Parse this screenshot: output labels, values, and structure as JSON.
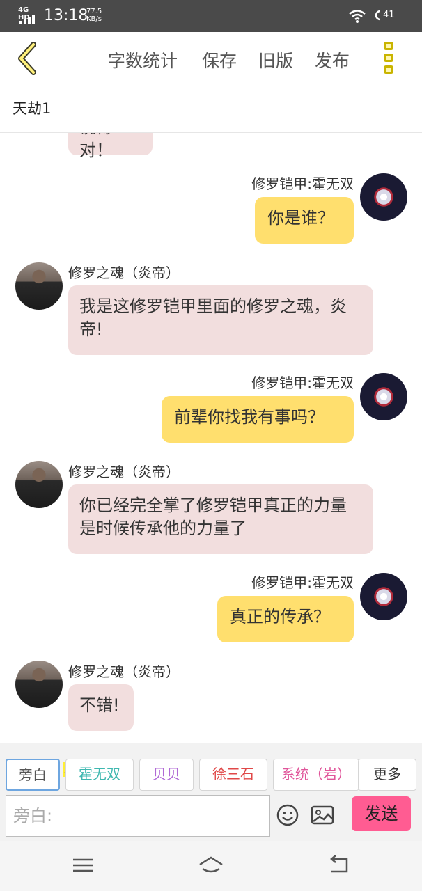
{
  "status_bar": {
    "network": "4G HD",
    "time": "13:18",
    "speed_value": "77.5",
    "speed_unit": "KB/s",
    "battery": "41"
  },
  "toolbar": {
    "items": [
      "字数统计",
      "保存",
      "旧版",
      "发布"
    ]
  },
  "doc_title": "天劫1",
  "messages": [
    {
      "side": "left",
      "name": "",
      "text": "说得对！"
    },
    {
      "side": "right",
      "name": "修罗铠甲:霍无双",
      "text": "你是谁？"
    },
    {
      "side": "left",
      "name": "修罗之魂（炎帝）",
      "text": "我是这修罗铠甲里面的修罗之魂，炎帝!"
    },
    {
      "side": "right",
      "name": "修罗铠甲:霍无双",
      "text": "前辈你找我有事吗？"
    },
    {
      "side": "left",
      "name": "修罗之魂（炎帝）",
      "text": "你已经完全掌了修罗铠甲真正的力量是时候传承他的力量了"
    },
    {
      "side": "right",
      "name": "修罗铠甲:霍无双",
      "text": "真正的传承？"
    },
    {
      "side": "left",
      "name": "修罗之魂（炎帝）",
      "text": "不错!"
    }
  ],
  "characters": {
    "main_tag": "主",
    "chips": [
      {
        "label": "旁白",
        "color": "#555555"
      },
      {
        "label": "霍无双",
        "color": "#3fb8b0"
      },
      {
        "label": "贝贝",
        "color": "#b06ad6"
      },
      {
        "label": "徐三石",
        "color": "#e04848"
      },
      {
        "label": "系统（岩）",
        "color": "#e0559a"
      },
      {
        "label": "更多",
        "color": "#333333"
      }
    ]
  },
  "input": {
    "placeholder": "旁白:",
    "value": ""
  },
  "send_label": "发送",
  "colors": {
    "left_bubble": "#f2dede",
    "right_bubble": "#ffdf6e",
    "send": "#ff5c92",
    "accent": "#c9b400"
  }
}
